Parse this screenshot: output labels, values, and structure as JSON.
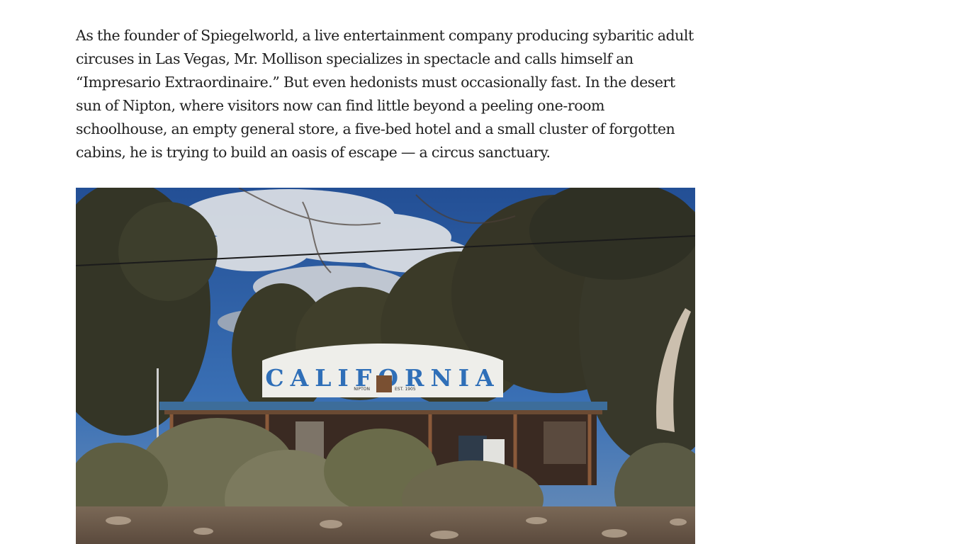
{
  "article": {
    "paragraph": "As the founder of Spiegelworld, a live entertainment company producing sybaritic adult circuses in Las Vegas, Mr. Mollison specializes in spectacle and calls himself an “Impresario Extraordinaire.” But even hedonists must occasionally fast. In the desert sun of Nipton, where visitors now can find little beyond a peeling one-room schoolhouse, an empty general store, a five-bed hotel and a small cluster of forgotten cabins, he is trying to build an oasis of escape — a circus sanctuary."
  },
  "photo": {
    "sign_text": "CALIFORNIA",
    "sign_left_text": "NIPTON",
    "sign_right_text": "EST. 1905"
  },
  "colors": {
    "text": "#222222",
    "sky": "#2a5fa8",
    "sign": "#eeeeea",
    "sign_letters": "#2f6fb8",
    "roof": "#3d6d9a"
  }
}
